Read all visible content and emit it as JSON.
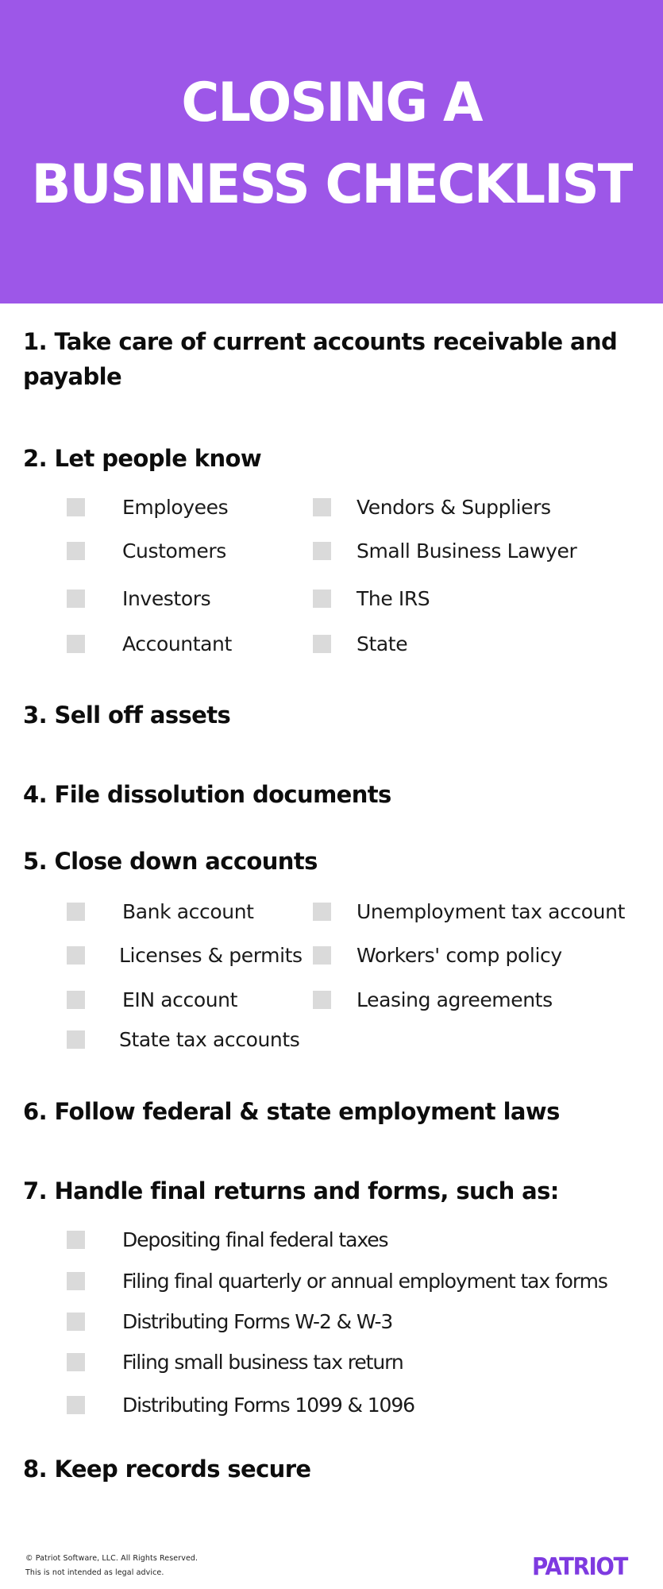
{
  "banner": {
    "title_line1": "CLOSING A",
    "title_line2": "BUSINESS CHECKLIST",
    "background_color": "#9d57e8"
  },
  "steps": [
    {
      "heading": "1. Take care of current accounts receivable and payable"
    },
    {
      "heading": "2. Let people know",
      "items_left": [
        "Employees",
        "Customers",
        "Investors",
        "Accountant"
      ],
      "items_right": [
        "Vendors & Suppliers",
        "Small Business Lawyer",
        "The IRS",
        "State"
      ]
    },
    {
      "heading": "3. Sell off assets"
    },
    {
      "heading": "4. File dissolution documents"
    },
    {
      "heading": "5. Close down accounts",
      "items_left": [
        "Bank account",
        "Licenses & permits",
        "EIN account",
        "State tax accounts"
      ],
      "items_right": [
        "Unemployment tax account",
        "Workers' comp policy",
        "Leasing agreements"
      ]
    },
    {
      "heading": "6. Follow federal & state employment laws"
    },
    {
      "heading": "7. Handle final returns and forms, such as:",
      "items": [
        "Depositing final federal taxes",
        "Filing final quarterly or annual employment tax forms",
        "Distributing Forms W-2 & W-3",
        "Filing small business tax return",
        "Distributing Forms 1099 & 1096"
      ]
    },
    {
      "heading": "8. Keep records secure"
    }
  ],
  "footer": {
    "copyright": "© Patriot Software, LLC. All Rights Reserved.",
    "disclaimer": "This is not intended as legal advice.",
    "logo_text": "PATRIOT",
    "logo_color": "#7e3ae0"
  },
  "checkbox_color": "#dadada"
}
